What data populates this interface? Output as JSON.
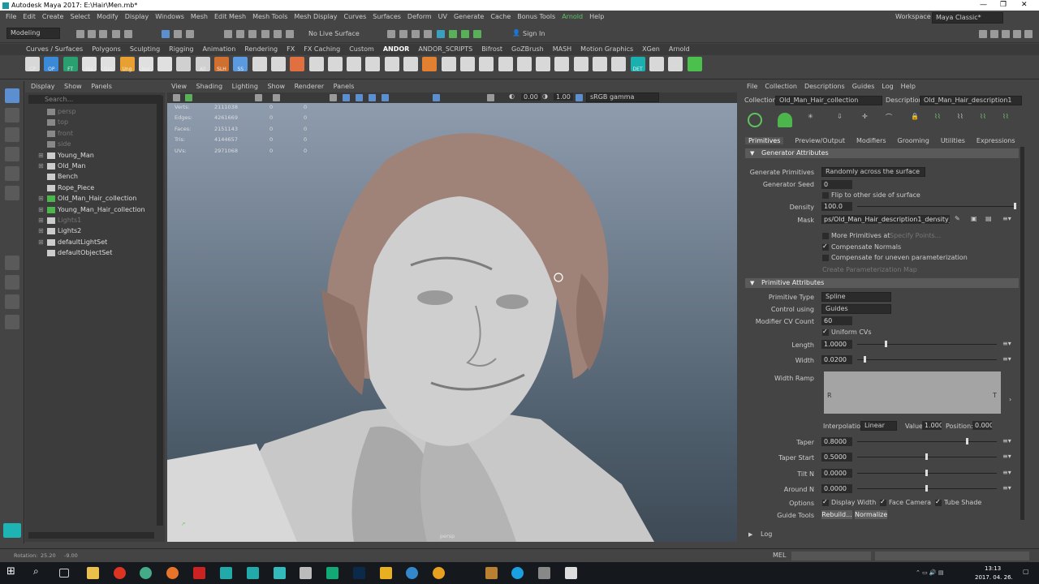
{
  "window": {
    "title": "Autodesk Maya 2017: E:\\Hair\\Men.mb*",
    "workspace_label": "Workspace :",
    "workspace_value": "Maya Classic*"
  },
  "menubar": [
    "File",
    "Edit",
    "Create",
    "Select",
    "Modify",
    "Display",
    "Windows",
    "Mesh",
    "Edit Mesh",
    "Mesh Tools",
    "Mesh Display",
    "Curves",
    "Surfaces",
    "Deform",
    "UV",
    "Generate",
    "Cache",
    "Bonus Tools",
    "Arnold",
    "Help"
  ],
  "status": {
    "mode": "Modeling",
    "live_surface": "No Live Surface",
    "sign_in": "Sign In"
  },
  "shelf_tabs": [
    "Curves / Surfaces",
    "Polygons",
    "Sculpting",
    "Rigging",
    "Animation",
    "Rendering",
    "FX",
    "FX Caching",
    "Custom",
    "ANDOR",
    "ANDOR_SCRIPTS",
    "Bifrost",
    "GoZBrush",
    "MASH",
    "Motion Graphics",
    "XGen",
    "Arnold"
  ],
  "shelf_labels": [
    "CP",
    "OP",
    "FT",
    "His",
    "Gro",
    "Ung",
    "Nor",
    "All",
    "SLH",
    "SS",
    "DET"
  ],
  "outliner": {
    "menu": [
      "Display",
      "Show",
      "Panels"
    ],
    "search_placeholder": "Search...",
    "items": [
      {
        "label": "persp",
        "dim": true,
        "expand": false,
        "icon": "camera"
      },
      {
        "label": "top",
        "dim": true,
        "expand": false,
        "icon": "camera"
      },
      {
        "label": "front",
        "dim": true,
        "expand": false,
        "icon": "camera"
      },
      {
        "label": "side",
        "dim": true,
        "expand": false,
        "icon": "camera"
      },
      {
        "label": "Young_Man",
        "dim": false,
        "expand": true,
        "icon": "mesh"
      },
      {
        "label": "Old_Man",
        "dim": false,
        "expand": true,
        "icon": "mesh"
      },
      {
        "label": "Bench",
        "dim": false,
        "expand": false,
        "icon": "mesh"
      },
      {
        "label": "Rope_Piece",
        "dim": false,
        "expand": false,
        "icon": "mesh"
      },
      {
        "label": "Old_Man_Hair_collection",
        "dim": false,
        "expand": true,
        "icon": "xgen"
      },
      {
        "label": "Young_Man_Hair_collection",
        "dim": false,
        "expand": true,
        "icon": "xgen"
      },
      {
        "label": "Lights1",
        "dim": true,
        "expand": true,
        "icon": "light"
      },
      {
        "label": "Lights2",
        "dim": false,
        "expand": true,
        "icon": "light"
      },
      {
        "label": "defaultLightSet",
        "dim": false,
        "expand": true,
        "icon": "set"
      },
      {
        "label": "defaultObjectSet",
        "dim": false,
        "expand": false,
        "icon": "set"
      }
    ]
  },
  "viewport": {
    "menu": [
      "View",
      "Shading",
      "Lighting",
      "Show",
      "Renderer",
      "Panels"
    ],
    "exposure": "0.00",
    "gamma": "1.00",
    "color_space": "sRGB gamma",
    "camera_label": "persp",
    "hud": [
      {
        "label": "Verts:",
        "v1": "2111038",
        "v2": "0",
        "v3": "0"
      },
      {
        "label": "Edges:",
        "v1": "4261669",
        "v2": "0",
        "v3": "0"
      },
      {
        "label": "Faces:",
        "v1": "2151143",
        "v2": "0",
        "v3": "0"
      },
      {
        "label": "Tris:",
        "v1": "4144657",
        "v2": "0",
        "v3": "0"
      },
      {
        "label": "UVs:",
        "v1": "2971068",
        "v2": "0",
        "v3": "0"
      }
    ]
  },
  "xgen": {
    "menu": [
      "File",
      "Collection",
      "Descriptions",
      "Guides",
      "Log",
      "Help"
    ],
    "collection_label": "Collection",
    "collection_value": "Old_Man_Hair_collection",
    "description_label": "Description",
    "description_value": "Old_Man_Hair_description1",
    "tabs": [
      "Primitives",
      "Preview/Output",
      "Modifiers",
      "Grooming",
      "Utilities",
      "Expressions"
    ],
    "generator": {
      "header": "Generator Attributes",
      "generate_label": "Generate Primitives",
      "generate_value": "Randomly across the surface",
      "seed_label": "Generator Seed",
      "seed_value": "0",
      "flip_label": "Flip to other side of surface",
      "density_label": "Density",
      "density_value": "100.0",
      "mask_label": "Mask",
      "mask_value": "ps/Old_Man_Hair_description1_density_mask",
      "more_label": "More Primitives at",
      "specify_label": "Specify Points...",
      "comp_normals": "Compensate Normals",
      "comp_uneven": "Compensate for uneven parameterization",
      "create_param": "Create Parameterization Map"
    },
    "primitive": {
      "header": "Primitive Attributes",
      "type_label": "Primitive Type",
      "type_value": "Spline",
      "control_label": "Control using",
      "control_value": "Guides",
      "cv_label": "Modifier CV Count",
      "cv_value": "60",
      "uniform_label": "Uniform CVs",
      "length_label": "Length",
      "length_value": "1.0000",
      "length_level": 0.2,
      "width_label": "Width",
      "width_value": "0.0200",
      "width_level": 0.05,
      "ramp_label": "Width Ramp",
      "ramp_left": "R",
      "ramp_right": "T",
      "interp_label": "Interpolation:",
      "interp_value": "Linear",
      "value_label": "Value:",
      "value_value": "1.000",
      "position_label": "Position:",
      "position_value": "0.000",
      "taper_label": "Taper",
      "taper_value": "0.8000",
      "taper_level": 0.8,
      "taperstart_label": "Taper Start",
      "taperstart_value": "0.5000",
      "taperstart_level": 0.5,
      "tilt_label": "Tilt N",
      "tilt_value": "0.0000",
      "tilt_level": 0.5,
      "around_label": "Around N",
      "around_value": "0.0000",
      "around_level": 0.5,
      "options_label": "Options",
      "display_width": "Display Width",
      "face_camera": "Face Camera",
      "tube_shade": "Tube Shade",
      "guide_tools_label": "Guide Tools",
      "rebuild": "Rebuild...",
      "normalize": "Normalize"
    },
    "log": "Log"
  },
  "helpline": {
    "rotation_label": "Rotation:",
    "rotation_x": "25.20",
    "rotation_y": "-9.00",
    "mel": "MEL"
  },
  "taskbar": {
    "time": "13:13",
    "date": "2017. 04. 26."
  }
}
